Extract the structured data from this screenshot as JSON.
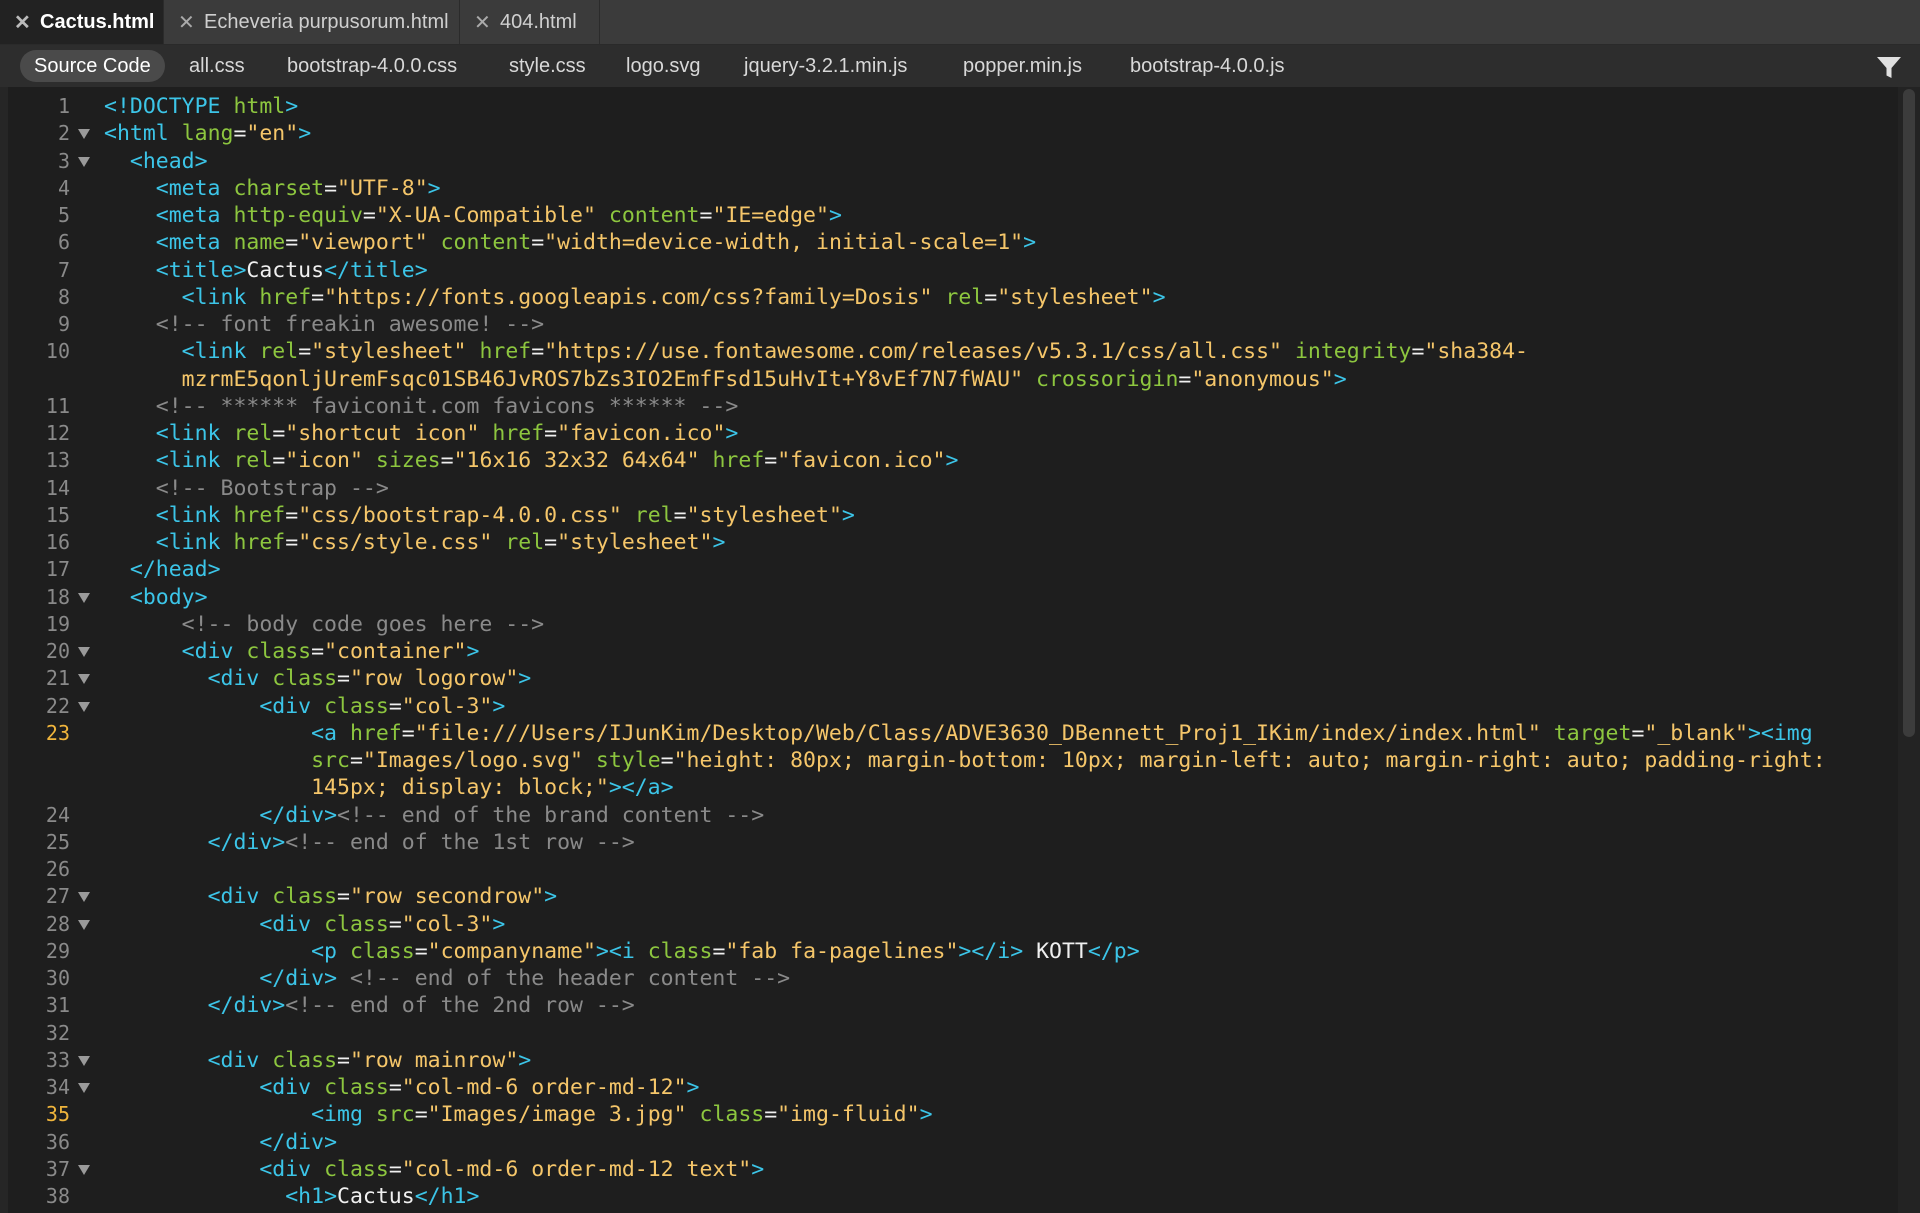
{
  "doc_tabs": [
    {
      "label": "Cactus.html",
      "close": "✕",
      "active": true
    },
    {
      "label": "Echeveria purpusorum.html",
      "close": "✕",
      "active": false
    },
    {
      "label": "404.html",
      "close": "✕",
      "active": false
    }
  ],
  "file_tabs": [
    {
      "label": "Source Code",
      "active": true
    },
    {
      "label": "all.css"
    },
    {
      "label": "bootstrap-4.0.0.css"
    },
    {
      "label": "style.css"
    },
    {
      "label": "logo.svg"
    },
    {
      "label": "jquery-3.2.1.min.js"
    },
    {
      "label": "popper.min.js"
    },
    {
      "label": "bootstrap-4.0.0.js"
    }
  ],
  "filter_icon": "filter-icon",
  "colors": {
    "tag": "#3cc5e8",
    "attribute": "#8dc63f",
    "value": "#f5c66a",
    "comment": "#8a8a8a",
    "highlight_line_number": "#f0b53c"
  },
  "code_lines": [
    {
      "num": "1",
      "code": "<!DOCTYPE html>"
    },
    {
      "num": "2",
      "code": "<html lang=\"en\">"
    },
    {
      "num": "3",
      "code": "  <head>"
    },
    {
      "num": "4",
      "code": "    <meta charset=\"UTF-8\">"
    },
    {
      "num": "5",
      "code": "    <meta http-equiv=\"X-UA-Compatible\" content=\"IE=edge\">"
    },
    {
      "num": "6",
      "code": "    <meta name=\"viewport\" content=\"width=device-width, initial-scale=1\">"
    },
    {
      "num": "7",
      "code": "    <title>Cactus</title>"
    },
    {
      "num": "8",
      "code": "      <link href=\"https://fonts.googleapis.com/css?family=Dosis\" rel=\"stylesheet\">"
    },
    {
      "num": "9",
      "code": "    <!-- font freakin awesome! -->"
    },
    {
      "num": "10",
      "code": "      <link rel=\"stylesheet\" href=\"https://use.fontawesome.com/releases/v5.3.1/css/all.css\" integrity=\"sha384-"
    },
    {
      "num": "",
      "code": "      mzrmE5qonljUremFsqc01SB46JvROS7bZs3IO2EmfFsd15uHvIt+Y8vEf7N7fWAU\" crossorigin=\"anonymous\">"
    },
    {
      "num": "11",
      "code": "    <!-- ****** faviconit.com favicons ****** -->"
    },
    {
      "num": "12",
      "code": "    <link rel=\"shortcut icon\" href=\"favicon.ico\">"
    },
    {
      "num": "13",
      "code": "    <link rel=\"icon\" sizes=\"16x16 32x32 64x64\" href=\"favicon.ico\">"
    },
    {
      "num": "14",
      "code": "    <!-- Bootstrap -->"
    },
    {
      "num": "15",
      "code": "    <link href=\"css/bootstrap-4.0.0.css\" rel=\"stylesheet\">"
    },
    {
      "num": "16",
      "code": "    <link href=\"css/style.css\" rel=\"stylesheet\">"
    },
    {
      "num": "17",
      "code": "  </head>"
    },
    {
      "num": "18",
      "code": "  <body>"
    },
    {
      "num": "19",
      "code": "      <!-- body code goes here -->"
    },
    {
      "num": "20",
      "code": "      <div class=\"container\">"
    },
    {
      "num": "21",
      "code": "        <div class=\"row logorow\">"
    },
    {
      "num": "22",
      "code": "            <div class=\"col-3\">"
    },
    {
      "num": "23",
      "code": "                <a href=\"file:///Users/IJunKim/Desktop/Web/Class/ADVE3630_DBennett_Proj1_IKim/index/index.html\" target=\"_blank\"><img"
    },
    {
      "num": "",
      "code": "                src=\"Images/logo.svg\" style=\"height: 80px; margin-bottom: 10px; margin-left: auto; margin-right: auto; padding-right:"
    },
    {
      "num": "",
      "code": "                145px; display: block;\"></a>"
    },
    {
      "num": "24",
      "code": "            </div><!-- end of the brand content -->"
    },
    {
      "num": "25",
      "code": "        </div><!-- end of the 1st row -->"
    },
    {
      "num": "26",
      "code": ""
    },
    {
      "num": "27",
      "code": "        <div class=\"row secondrow\">"
    },
    {
      "num": "28",
      "code": "            <div class=\"col-3\">"
    },
    {
      "num": "29",
      "code": "                <p class=\"companyname\"><i class=\"fab fa-pagelines\"></i> KOTT</p>"
    },
    {
      "num": "30",
      "code": "            </div> <!-- end of the header content -->"
    },
    {
      "num": "31",
      "code": "        </div><!-- end of the 2nd row -->"
    },
    {
      "num": "32",
      "code": ""
    },
    {
      "num": "33",
      "code": "        <div class=\"row mainrow\">"
    },
    {
      "num": "34",
      "code": "            <div class=\"col-md-6 order-md-12\">"
    },
    {
      "num": "35",
      "code": "                <img src=\"Images/image 3.jpg\" class=\"img-fluid\">"
    },
    {
      "num": "36",
      "code": "            </div>"
    },
    {
      "num": "37",
      "code": "            <div class=\"col-md-6 order-md-12 text\">"
    },
    {
      "num": "38",
      "code": "              <h1>Cactus</h1>"
    }
  ]
}
